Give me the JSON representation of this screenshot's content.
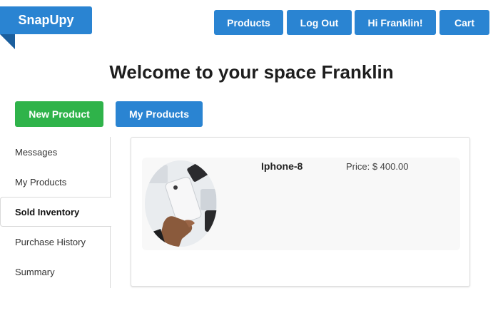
{
  "brand": {
    "name": "SnapUpy"
  },
  "nav": {
    "products": "Products",
    "logout": "Log Out",
    "user": "Hi Franklin!",
    "cart": "Cart"
  },
  "welcome": "Welcome to your space Franklin",
  "actions": {
    "new_product": "New Product",
    "my_products": "My Products"
  },
  "sidebar": {
    "items": [
      {
        "label": "Messages",
        "active": false
      },
      {
        "label": "My Products",
        "active": false
      },
      {
        "label": "Sold Inventory",
        "active": true
      },
      {
        "label": "Purchase History",
        "active": false
      },
      {
        "label": "Summary",
        "active": false
      }
    ]
  },
  "product": {
    "name": "Iphone-8",
    "price": "Price: $ 400.00",
    "image": "hand-holding-phone-photo"
  },
  "colors": {
    "primary": "#2a84d2",
    "success": "#2fb34a"
  }
}
